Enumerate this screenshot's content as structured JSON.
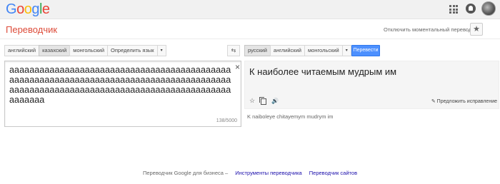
{
  "header": {
    "logo": [
      "G",
      "o",
      "o",
      "g",
      "l",
      "e"
    ],
    "logo_colors": [
      "#4285f4",
      "#ea4335",
      "#fbbc05",
      "#4285f4",
      "#34a853",
      "#ea4335"
    ]
  },
  "toolbar": {
    "page_title": "Переводчик",
    "instant_toggle": "Отключить моментальный перевод",
    "star_icon": "★"
  },
  "source_langs": {
    "items": [
      "английский",
      "казахский",
      "монгольский",
      "Определить язык"
    ],
    "active_index": 1,
    "dropdown": "▾"
  },
  "swap_icon": "⇆",
  "target_langs": {
    "items": [
      "русский",
      "английский",
      "монгольский"
    ],
    "active_index": 0,
    "dropdown": "▾"
  },
  "translate_button": "Перевести",
  "source": {
    "text": "aaaaaaaaaaaaaaaaaaaaaaaaaaaaaaaaaaaaaaaaaaaaaaaaaaaaaaaaaaaaaaaaaaaaaaaaaaaaaaaaaaaaaaaaaaaaaaaaaaaaaaaaaaaaaaaaaaaaaaaaaaaaaaaaaaaaaaaaaaa",
    "clear_icon": "×",
    "char_count": "138/5000"
  },
  "result": {
    "text": "К наиболее читаемым мудрым им",
    "star_icon": "☆",
    "speaker_icon": "🔊",
    "suggest_edit": "✎ Предложить исправление",
    "transliteration": "K naiboleye chitayemym mudrym im"
  },
  "footer": {
    "text": "Переводчик Google для бизнеса –",
    "link1": "Инструменты переводчика",
    "link2": "Переводчик сайтов"
  }
}
